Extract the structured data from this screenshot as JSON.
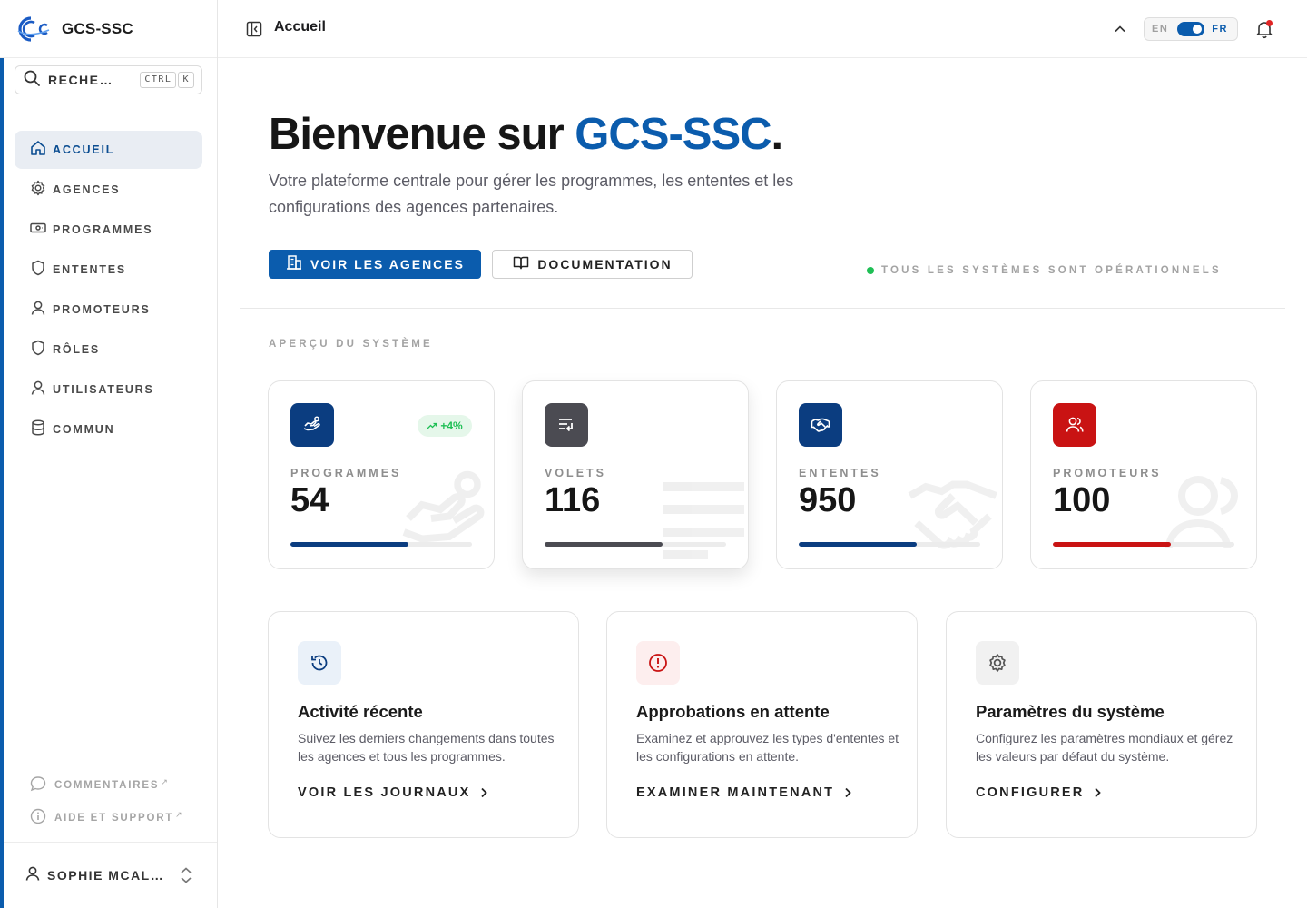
{
  "brand": {
    "name": "GCS-SSC",
    "logo_icon": "gcs-logo",
    "accent_color": "#0b5cad"
  },
  "search": {
    "label": "RECHERCHER",
    "shortcut_keys": [
      "CTRL",
      "K"
    ],
    "icon": "search-icon"
  },
  "sidebar": {
    "items": [
      {
        "label": "ACCUEIL",
        "icon": "home-icon",
        "active": true
      },
      {
        "label": "AGENCES",
        "icon": "gear-icon"
      },
      {
        "label": "PROGRAMMES",
        "icon": "banknote-icon"
      },
      {
        "label": "ENTENTES",
        "icon": "shield-icon"
      },
      {
        "label": "PROMOTEURS",
        "icon": "user-icon"
      },
      {
        "label": "RÔLES",
        "icon": "shield-icon"
      },
      {
        "label": "UTILISATEURS",
        "icon": "user-icon"
      },
      {
        "label": "COMMUN",
        "icon": "database-icon"
      }
    ],
    "footer_links": [
      {
        "label": "COMMENTAIRES",
        "icon": "comment-icon",
        "external": "↗"
      },
      {
        "label": "AIDE ET SUPPORT",
        "icon": "info-icon",
        "external": "↗"
      }
    ],
    "user": {
      "name": "SOPHIE MCALLISTER",
      "icon": "user-icon"
    }
  },
  "topbar": {
    "breadcrumb": "Accueil",
    "language": {
      "off": "EN",
      "on": "FR",
      "selected": "FR"
    },
    "notification_dot_color": "#e02424"
  },
  "hero": {
    "title_prefix": "Bienvenue sur ",
    "title_brand": "GCS-SSC",
    "title_suffix": ".",
    "subtitle": "Votre plateforme centrale pour gérer les programmes, les ententes et les configurations des agences partenaires.",
    "primary_button": "VOIR LES AGENCES",
    "secondary_button": "DOCUMENTATION",
    "status": "TOUS LES SYSTÈMES SONT OPÉRATIONNELS",
    "status_color": "#1fbf55"
  },
  "overview": {
    "section_label": "APERÇU DU SYSTÈME",
    "stats": [
      {
        "label": "PROGRAMMES",
        "value": "54",
        "trend": "+4%",
        "color": "#0b3d80",
        "progress": 0.65
      },
      {
        "label": "VOLETS",
        "value": "116",
        "color": "#4b4b52",
        "progress": 0.65
      },
      {
        "label": "ENTENTES",
        "value": "950",
        "color": "#0b3d80",
        "progress": 0.65
      },
      {
        "label": "PROMOTEURS",
        "value": "100",
        "color": "#c91313",
        "progress": 0.65
      }
    ]
  },
  "features": [
    {
      "title": "Activité récente",
      "description": "Suivez les derniers changements dans toutes les agences et tous les programmes.",
      "link": "VOIR LES JOURNAUX",
      "icon": "history-icon",
      "icon_color": "#0b3d80",
      "icon_bg": "#eaf1f9"
    },
    {
      "title": "Approbations en attente",
      "description": "Examinez et approuvez les types d'ententes et les configurations en attente.",
      "link": "EXAMINER MAINTENANT",
      "icon": "alert-circle-icon",
      "icon_color": "#c91313",
      "icon_bg": "#fdeeee"
    },
    {
      "title": "Paramètres du système",
      "description": "Configurez les paramètres mondiaux et gérez les valeurs par défaut du système.",
      "link": "CONFIGURER",
      "icon": "gear-icon",
      "icon_color": "#555555",
      "icon_bg": "#f1f1f1"
    }
  ]
}
